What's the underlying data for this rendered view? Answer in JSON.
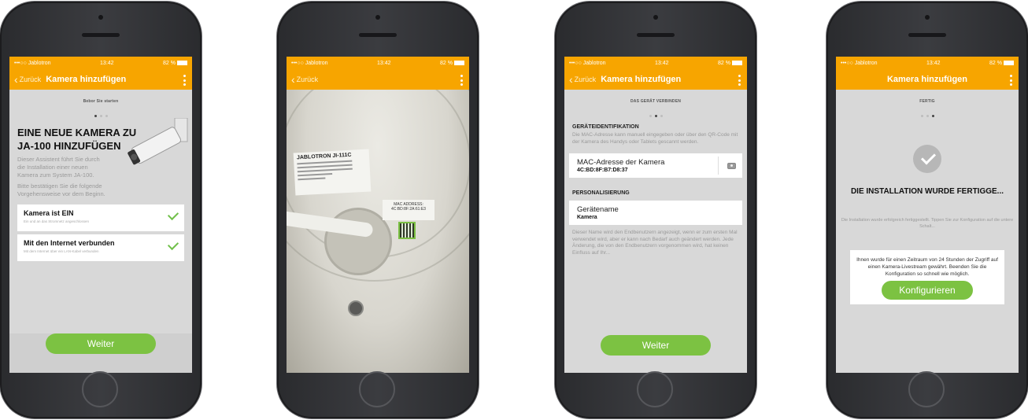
{
  "statusbar": {
    "carrier": "•••○○ Jablotron",
    "time": "13:42",
    "battery": "82 %"
  },
  "screen1": {
    "back_label": "Zurück",
    "title": "Kamera hinzufügen",
    "step_name": "Bebor Sie starten",
    "heading_line1": "EINE NEUE KAMERA ZU",
    "heading_line2": "JA-100 HINZUFÜGEN",
    "description": "Dieser Assistent führt Sie durch die Installation einer neuen Kamera zum System JA-100.",
    "confirm_text": "Bitte bestätigen Sie die folgende Vorgehensweise vor dem Beginn.",
    "items": [
      {
        "title": "Kamera ist EIN",
        "subtitle": "Ein und an das Stromnetz angeschlossen"
      },
      {
        "title": "Mit den Internet verbunden",
        "subtitle": "Mit dem Internet über ein LAN-Kabel verbunden"
      }
    ],
    "button": "Weiter"
  },
  "screen2": {
    "back_label": "Zurück",
    "photo_label_brand": "JABLOTRON  JI-111C",
    "photo_label_mac_title": "MAC ADDRESS:",
    "photo_label_mac": "4C:BD:8F:2A:61:E3"
  },
  "screen3": {
    "back_label": "Zurück",
    "title": "Kamera hinzufügen",
    "step_name": "DAS GERÄT VERBINDEN",
    "section1": "GERÄTEIDENTIFIKATION",
    "section1_text": "Die MAC-Adresse kann manuell eingegeben oder über den QR-Code mit der Kamera des Handys oder Tablets gescannt werden.",
    "mac_label": "MAC-Adresse der Kamera",
    "mac_value": "4C:BD:8F:B7:D8:37",
    "section2": "PERSONALISIERUNG",
    "name_label": "Gerätename",
    "name_value": "Kamera",
    "name_text": "Dieser Name wird den Endbenutzern angezeigt, wenn er zum ersten Mal verwendet wird, aber er kann nach Bedarf auch geändert werden. Jede Änderung, die von den Endbenutzern vorgenommen wird, hat keinen Einfluss auf Ihr...",
    "button": "Weiter"
  },
  "screen4": {
    "title": "Kamera hinzufügen",
    "step_name": "FERTIG",
    "heading": "DIE INSTALLATION WURDE FERTIGGE...",
    "info": "Die Installation wurde erfolgreich fertiggestellt. Tippen Sie zur Konfiguration auf die untere Schalt...",
    "note": "Ihnen wurde für einen Zeitraum von 24 Stunden der Zugriff auf einen Kamera-Livestream gewährt. Beenden Sie die Konfiguration so schnell wie möglich.",
    "button": "Konfigurieren"
  },
  "colors": {
    "accent": "#f7a500",
    "button_green": "#7cc242",
    "check_green": "#71c04a"
  }
}
